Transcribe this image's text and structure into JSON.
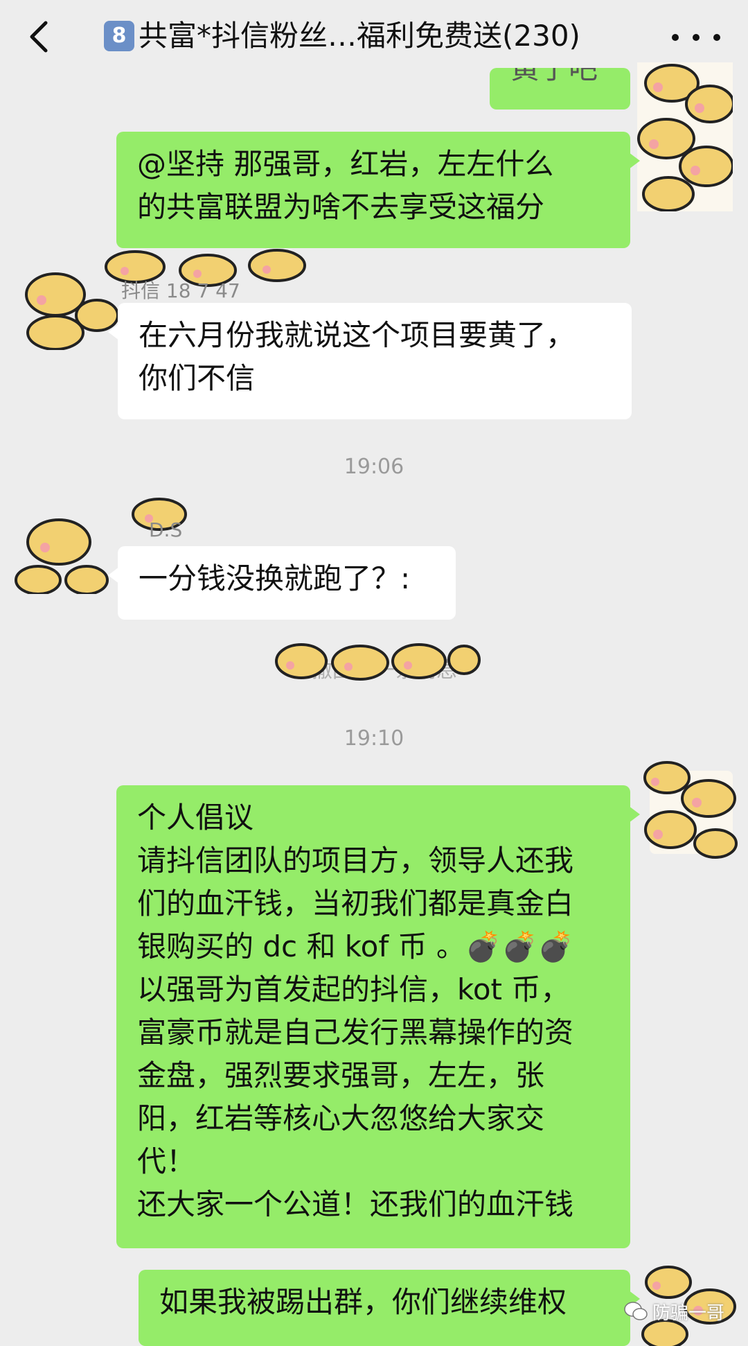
{
  "header": {
    "badge": "8",
    "title": "共富*抖信粉丝…福利免费送(230)"
  },
  "messages": {
    "m0": {
      "text": "黄了吧"
    },
    "m1": {
      "lines": [
        "@坚持  那强哥，红岩，左左什么",
        "的共富联盟为啥不去享受这福分"
      ]
    },
    "m2": {
      "sender": "抖信 18   7   47",
      "lines": [
        "在六月份我就说这个项目要黄了，",
        "你们不信"
      ]
    },
    "m3": {
      "sender": "D.S",
      "text": "一分钱没换就跑了？:"
    },
    "m4": {
      "lines": [
        "个人倡议",
        "请抖信团队的项目方，领导人还我",
        "们的血汗钱，当初我们都是真金白",
        "银购买的 dc 和 kof 币 。",
        "以强哥为首发起的抖信，kot 币，",
        "富豪币就是自己发行黑幕操作的资",
        "金盘，强烈要求强哥，左左，张",
        "阳，红岩等核心大忽悠给大家交",
        "代！",
        "还大家一个公道！还我们的血汗钱"
      ],
      "bombs": "💣💣💣"
    },
    "m5": {
      "text": "如果我被踢出群，你们继续维权"
    }
  },
  "times": {
    "t1": "19:06",
    "t2": "19:10"
  },
  "system": {
    "recall": "你撤回了一条消息"
  },
  "watermark": {
    "text": "防骗一哥"
  },
  "colors": {
    "green_bubble": "#95ec69",
    "background": "#ededed",
    "white_bubble": "#ffffff"
  }
}
